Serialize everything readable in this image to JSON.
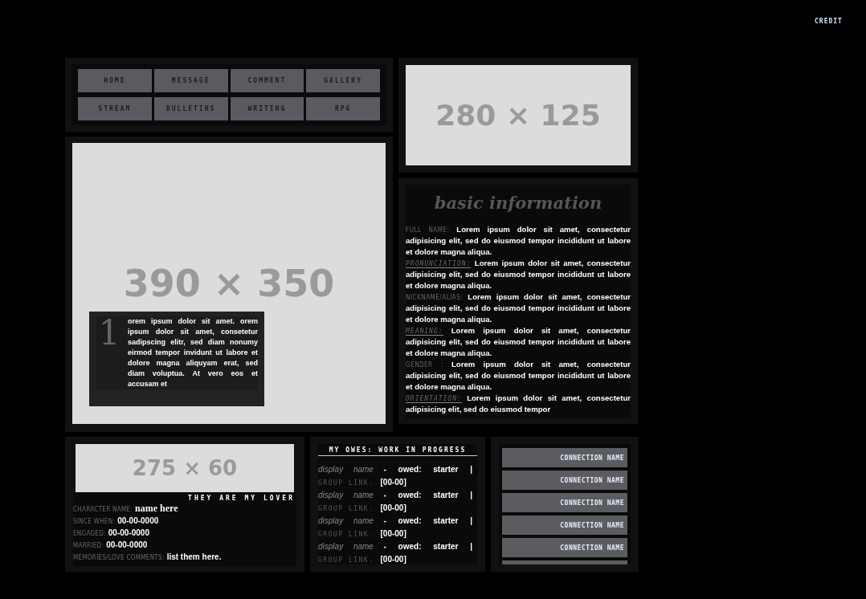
{
  "credit": "CREDIT",
  "nav": [
    {
      "label": "HOME"
    },
    {
      "label": "MESSAGE"
    },
    {
      "label": "COMMENT"
    },
    {
      "label": "GALLERY"
    },
    {
      "label": "STREAM"
    },
    {
      "label": "BULLETINS"
    },
    {
      "label": "WRITING"
    },
    {
      "label": "RPG"
    }
  ],
  "main_image": {
    "placeholder": "390 × 350"
  },
  "caption": {
    "initial": "1",
    "text": "orem ipsum dolor sit amet. orem ipsum dolor sit amet, consetetur sadipscing elitr, sed diam nonumy eirmod tempor invidunt ut labore et dolore magna aliquyam erat, sed diam voluptua. At vero eos et accusam et"
  },
  "side_image": {
    "placeholder": "280 × 125"
  },
  "basic_info": {
    "title": "basic information",
    "fields": [
      {
        "kind": "plain",
        "label": "FULL NAME:",
        "value": "Lorem ipsum dolor sit amet, consectetur adipisicing elit, sed do eiusmod tempor incididunt ut labore et dolore magna aliqua."
      },
      {
        "kind": "underlined",
        "label": "PRONUNCIATION:",
        "value": "Lorem ipsum dolor sit amet, consectetur adipisicing elit, sed do eiusmod tempor incididunt ut labore et dolore magna aliqua."
      },
      {
        "kind": "plain",
        "label": "NICKNAME/ALIAS:",
        "value": "Lorem ipsum dolor sit amet, consectetur adipisicing elit, sed do eiusmod tempor incididunt ut labore et dolore magna aliqua."
      },
      {
        "kind": "underlined",
        "label": "MEANING:",
        "value": "Lorem ipsum dolor sit amet, consectetur adipisicing elit, sed do eiusmod tempor incididunt ut labore et dolore magna aliqua."
      },
      {
        "kind": "plain",
        "label": "GENDER :",
        "value": "Lorem ipsum dolor sit amet, consectetur adipisicing elit, sed do eiusmod tempor incididunt ut labore et dolore magna aliqua."
      },
      {
        "kind": "underlined",
        "label": "ORIENTATION:",
        "value": "Lorem ipsum dolor sit amet, consectetur adipisicing elit, sed do eiusmod tempor"
      }
    ]
  },
  "lover": {
    "image_placeholder": "275 × 60",
    "heading": "THEY ARE MY LOVER",
    "fields": [
      {
        "kind": "name",
        "label": "CHARACTER NAME:",
        "value": "name here"
      },
      {
        "kind": "plain",
        "label": "SINCE WHEN:",
        "value": "00-00-0000"
      },
      {
        "kind": "plain",
        "label": "ENGAGED:",
        "value": "00-00-0000"
      },
      {
        "kind": "plain",
        "label": "MARRIED:",
        "value": "00-00-0000"
      },
      {
        "kind": "plain",
        "label": "MEMORIES/LOVE COMMENTS:",
        "value": "list them here."
      }
    ]
  },
  "owes": {
    "title": "MY OWES: WORK IN PROGRESS",
    "entries": [
      {
        "name": "display name",
        "owed": "- owed: starter |",
        "link_label": "GROUP LINK.",
        "link": "[00-00]"
      },
      {
        "name": "display name",
        "owed": "- owed: starter |",
        "link_label": "GROUP LINK.",
        "link": "[00-00]"
      },
      {
        "name": "display name",
        "owed": "- owed: starter |",
        "link_label": "GROUP LINK.",
        "link": "[00-00]"
      },
      {
        "name": "display name",
        "owed": "- owed: starter |",
        "link_label": "GROUP LINK.",
        "link": "[00-00]"
      }
    ]
  },
  "connections": [
    {
      "label": "CONNECTION NAME"
    },
    {
      "label": "CONNECTION NAME"
    },
    {
      "label": "CONNECTION NAME"
    },
    {
      "label": "CONNECTION NAME"
    },
    {
      "label": "CONNECTION NAME"
    }
  ]
}
